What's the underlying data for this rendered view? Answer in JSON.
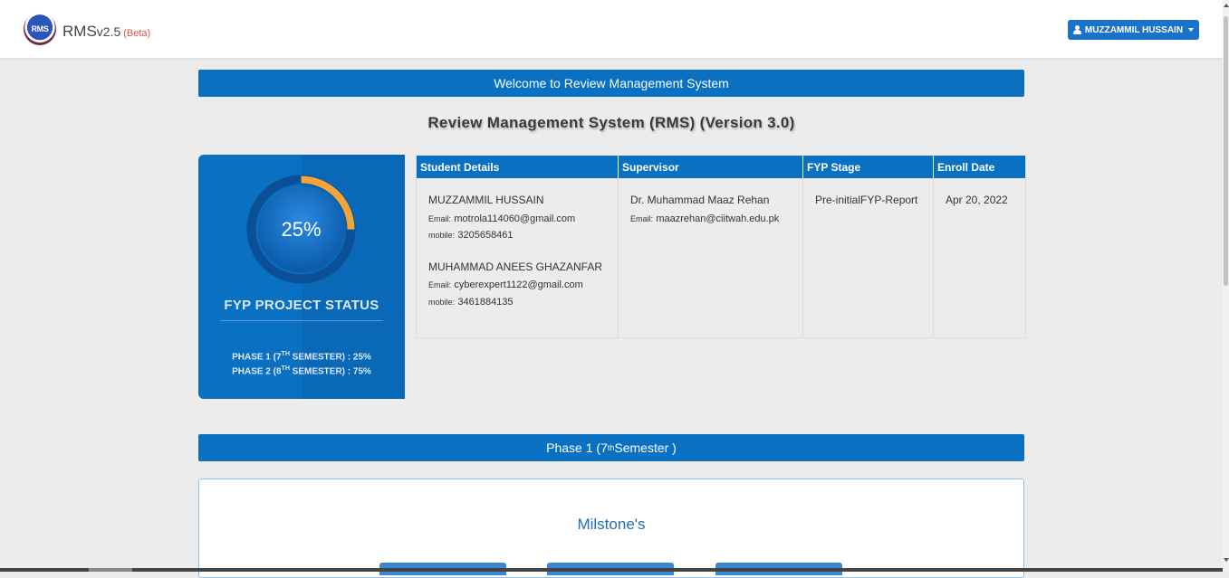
{
  "header": {
    "logo_text": "RMS",
    "brand_name": "RMS",
    "brand_version": "v2.5",
    "brand_beta": "(Beta)",
    "user_name": "MUZZAMMIL HUSSAIN"
  },
  "welcome_text": "Welcome to Review Management System",
  "page_title": "Review Management System (RMS) (Version 3.0)",
  "status_card": {
    "progress": 25,
    "progress_label": "25%",
    "label": "FYP PROJECT STATUS",
    "phase1_prefix": "PHASE 1 (7",
    "phase1_sup": "TH",
    "phase1_suffix": " SEMESTER) : 25%",
    "phase2_prefix": "PHASE 2 (8",
    "phase2_sup": "TH",
    "phase2_suffix": " SEMESTER) : 75%"
  },
  "details": {
    "headers": [
      "Student Details",
      "Supervisor",
      "FYP Stage",
      "Enroll Date"
    ],
    "students": [
      {
        "name": "MUZZAMMIL HUSSAIN",
        "email_label": "Email:",
        "email": "motrola114060@gmail.com",
        "mobile_label": "mobile:",
        "mobile": "3205658461"
      },
      {
        "name": "MUHAMMAD ANEES GHAZANFAR",
        "email_label": "Email:",
        "email": "cyberexpert1122@gmail.com",
        "mobile_label": "mobile:",
        "mobile": "3461884135"
      }
    ],
    "supervisor": {
      "name": "Dr. Muhammad Maaz Rehan",
      "email_label": "Email:",
      "email": "maazrehan@ciitwah.edu.pk"
    },
    "fyp_stage": "Pre-initialFYP-Report",
    "enroll_date": "Apr 20, 2022"
  },
  "phase_banner": {
    "prefix": "Phase 1 (7",
    "sup": "th",
    "suffix": " Semester )"
  },
  "milestones_title": "Milstone's",
  "colors": {
    "primary": "#0a70c2",
    "gauge_progress": "#f0a43a",
    "beta": "#d9534f"
  }
}
